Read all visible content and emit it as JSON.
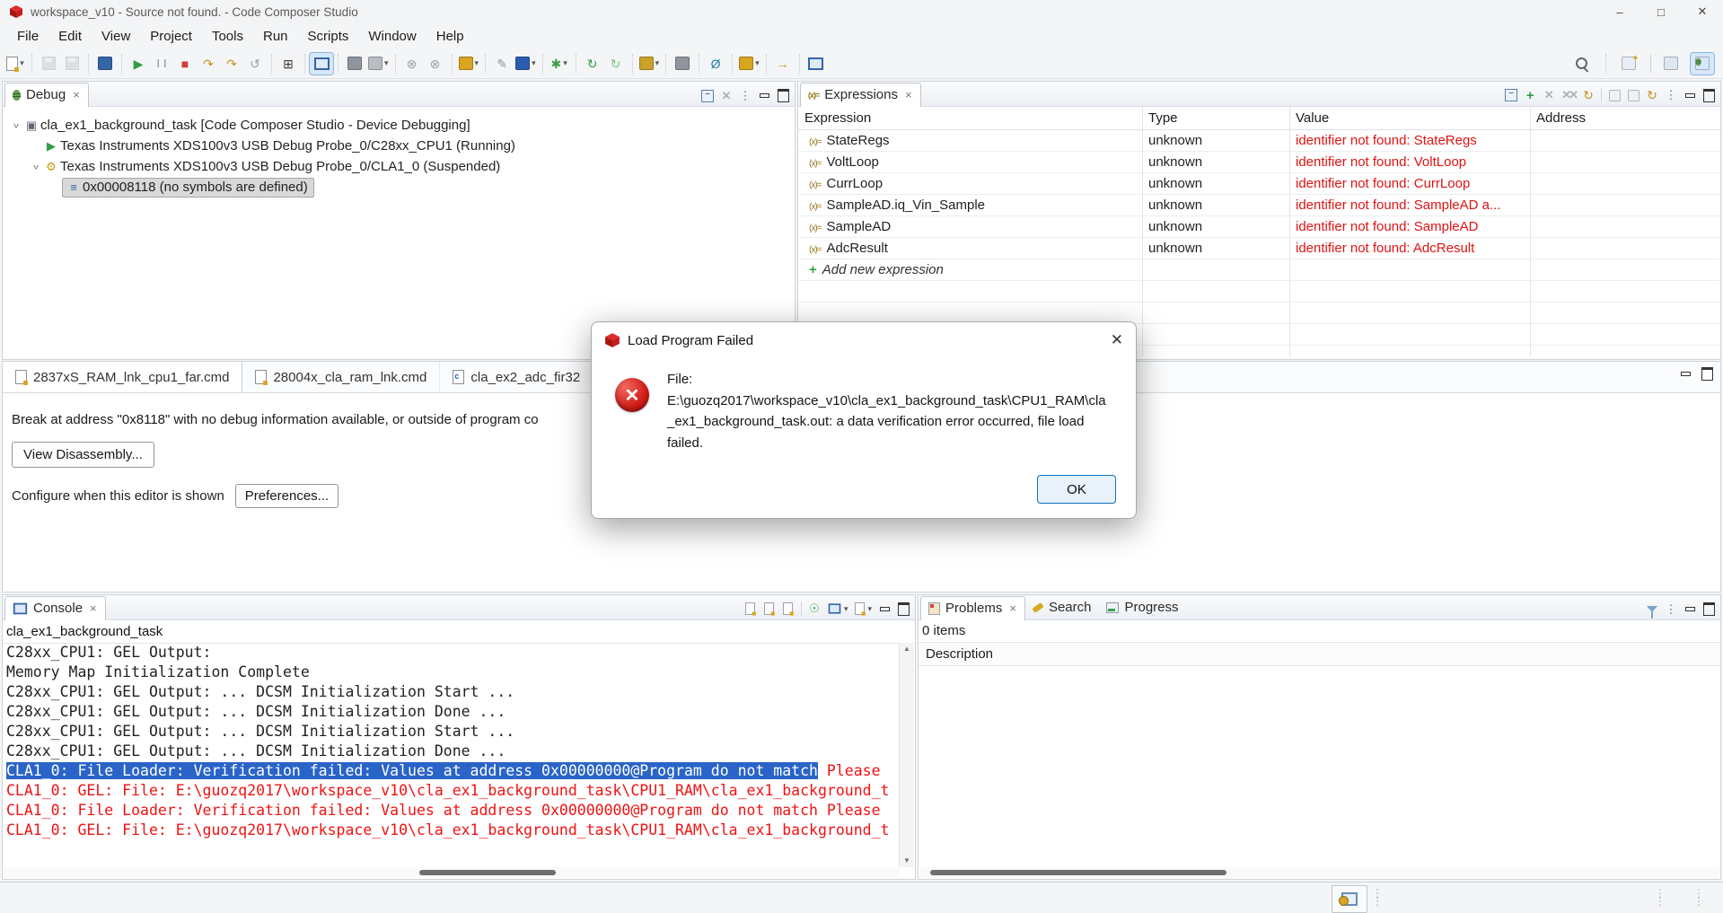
{
  "window": {
    "title": "workspace_v10 - Source not found. - Code Composer Studio"
  },
  "menubar": {
    "items": [
      "File",
      "Edit",
      "View",
      "Project",
      "Tools",
      "Run",
      "Scripts",
      "Window",
      "Help"
    ]
  },
  "main_toolbar": {
    "groups": [
      [
        {
          "n": "new-file-button",
          "css": "doc",
          "dd": 1
        }
      ],
      [
        {
          "n": "save-button",
          "css": "disk",
          "dis": 1
        },
        {
          "n": "save-all-button",
          "css": "disk",
          "dis": 1
        }
      ],
      [
        {
          "n": "build-button",
          "chip": "#3465a4"
        }
      ],
      [
        {
          "n": "resume-button",
          "g": "▶",
          "c": "#2f9e44"
        },
        {
          "n": "pause-button",
          "g": "❙❙",
          "c": "#9aa0a6",
          "small": 1
        },
        {
          "n": "stop-button",
          "g": "■",
          "c": "#d43a3a"
        },
        {
          "n": "step-into-button",
          "g": "↷",
          "c": "#c8941a"
        },
        {
          "n": "step-over-button",
          "g": "↷",
          "c": "#c8941a"
        },
        {
          "n": "step-return-button",
          "g": "↺",
          "c": "#9aa0a6"
        }
      ],
      [
        {
          "n": "registers-button",
          "g": "⊞",
          "c": "#3b3b3b"
        }
      ],
      [
        {
          "n": "source-lookup-button",
          "css": "mon",
          "hl": 1
        }
      ],
      [
        {
          "n": "profile-button",
          "chip": "#8f959c"
        },
        {
          "n": "trace-button",
          "chip": "#b9bec4",
          "dd": 1
        }
      ],
      [
        {
          "n": "skip-all-breakpoints-button",
          "g": "⊗",
          "c": "#9aa0a6"
        },
        {
          "n": "remove-breakpoints-button",
          "g": "⊗",
          "c": "#9aa0a6"
        }
      ],
      [
        {
          "n": "flash-button",
          "chip": "#d9a520",
          "dd": 1
        }
      ],
      [
        {
          "n": "memory-save-button",
          "g": "✎",
          "c": "#8f959c"
        },
        {
          "n": "pin-expression-button",
          "chip": "#2a5db0",
          "dd": 1
        }
      ],
      [
        {
          "n": "new-breakpoint-button",
          "g": "✱",
          "c": "#3f9e4d",
          "dd": 1
        }
      ],
      [
        {
          "n": "refresh-button",
          "g": "↻",
          "c": "#2f9e44"
        },
        {
          "n": "reload-program-button",
          "g": "↻",
          "c": "#7bc47f"
        }
      ],
      [
        {
          "n": "build-hammer-button",
          "chip": "#c9a227",
          "dd": 1
        }
      ],
      [
        {
          "n": "target-config-button",
          "chip": "#8f959c"
        }
      ],
      [
        {
          "n": "halt-button",
          "g": "Ø",
          "c": "#1e7ea1"
        }
      ],
      [
        {
          "n": "flashlight-button",
          "chip": "#d9a520",
          "dd": 1
        }
      ],
      [
        {
          "n": "forward-button",
          "g": "→",
          "c": "#c8941a"
        }
      ],
      [
        {
          "n": "open-new-view-button",
          "css": "mon"
        }
      ]
    ],
    "right": {
      "search": "search-button",
      "open_perspective": "open-perspective-button",
      "perspectives": [
        {
          "n": "ccs-edit-perspective-button",
          "active": false
        },
        {
          "n": "ccs-debug-perspective-button",
          "active": true
        }
      ]
    }
  },
  "debug_panel": {
    "tab": "Debug",
    "tree": [
      {
        "depth": 0,
        "chev": "v",
        "icon": "session",
        "label": "cla_ex1_background_task [Code Composer Studio - Device Debugging]",
        "selected": false
      },
      {
        "depth": 1,
        "chev": "",
        "icon": "running",
        "label": "Texas Instruments XDS100v3 USB Debug Probe_0/C28xx_CPU1 (Running)",
        "selected": false
      },
      {
        "depth": 1,
        "chev": "v",
        "icon": "suspended",
        "label": "Texas Instruments XDS100v3 USB Debug Probe_0/CLA1_0 (Suspended)",
        "selected": false
      },
      {
        "depth": 2,
        "chev": "",
        "icon": "frame",
        "label": "0x00008118  (no symbols are defined)",
        "selected": true
      }
    ],
    "icon_glyphs": {
      "session": [
        "▣",
        "#5f6771"
      ],
      "running": [
        "▶",
        "#2f9e44"
      ],
      "suspended": [
        "⚙",
        "#c59a1a"
      ],
      "frame": [
        "≡",
        "#3465a4"
      ]
    }
  },
  "expressions_panel": {
    "tab": "Expressions",
    "columns": [
      "Expression",
      "Type",
      "Value",
      "Address"
    ],
    "rows": [
      {
        "expression": "StateRegs",
        "type": "unknown",
        "value": "identifier not found: StateRegs",
        "address": ""
      },
      {
        "expression": "VoltLoop",
        "type": "unknown",
        "value": "identifier not found: VoltLoop",
        "address": ""
      },
      {
        "expression": "CurrLoop",
        "type": "unknown",
        "value": "identifier not found: CurrLoop",
        "address": ""
      },
      {
        "expression": "SampleAD.iq_Vin_Sample",
        "type": "unknown",
        "value": "identifier not found: SampleAD a...",
        "address": ""
      },
      {
        "expression": "SampleAD",
        "type": "unknown",
        "value": "identifier not found: SampleAD",
        "address": ""
      },
      {
        "expression": "AdcResult",
        "type": "unknown",
        "value": "identifier not found: AdcResult",
        "address": ""
      }
    ],
    "add_row_label": "Add new expression",
    "empty_row_count": 4
  },
  "editor_area": {
    "tabs": [
      {
        "label": "2837xS_RAM_lnk_cpu1_far.cmd",
        "icon": "cmd-file",
        "active": true
      },
      {
        "label": "28004x_cla_ram_lnk.cmd",
        "icon": "cmd-file",
        "active": false
      },
      {
        "label": "cla_ex2_adc_fir32",
        "icon": "c-file",
        "active": false
      }
    ],
    "message": "Break at address \"0x8118\" with no debug information available, or outside of program co",
    "view_disassembly_label": "View Disassembly...",
    "configure_text": "Configure when this editor is shown",
    "preferences_label": "Preferences..."
  },
  "dialog": {
    "title": "Load Program Failed",
    "message_lines": [
      "File:",
      "E:\\guozq2017\\workspace_v10\\cla_ex1_background_task\\CPU1_RAM\\cla",
      "_ex1_background_task.out: a data verification error occurred, file load",
      "failed."
    ],
    "ok_label": "OK"
  },
  "console_panel": {
    "tab": "Console",
    "subtitle": "cla_ex1_background_task",
    "lines": [
      {
        "text": "C28xx_CPU1: GEL Output: ",
        "style": "normal"
      },
      {
        "text": "Memory Map Initialization Complete",
        "style": "normal"
      },
      {
        "text": "C28xx_CPU1: GEL Output: ... DCSM Initialization Start ...",
        "style": "normal"
      },
      {
        "text": "C28xx_CPU1: GEL Output: ... DCSM Initialization Done ...",
        "style": "normal"
      },
      {
        "text": "C28xx_CPU1: GEL Output: ... DCSM Initialization Start ...",
        "style": "normal"
      },
      {
        "text": "C28xx_CPU1: GEL Output: ... DCSM Initialization Done ...",
        "style": "normal"
      },
      {
        "text": "CLA1_0: File Loader: Verification failed: Values at address 0x00000000@Program do not match",
        "style": "error",
        "selected": true,
        "suffix": " Please"
      },
      {
        "text": "CLA1_0: GEL: File: E:\\guozq2017\\workspace_v10\\cla_ex1_background_task\\CPU1_RAM\\cla_ex1_background_t",
        "style": "error"
      },
      {
        "text": "CLA1_0: File Loader: Verification failed: Values at address 0x00000000@Program do not match Please",
        "style": "error"
      },
      {
        "text": "CLA1_0: GEL: File: E:\\guozq2017\\workspace_v10\\cla_ex1_background_task\\CPU1_RAM\\cla_ex1_background_t",
        "style": "error"
      }
    ]
  },
  "problems_panel": {
    "tabs": [
      {
        "label": "Problems",
        "icon": "problems",
        "active": true
      },
      {
        "label": "Search",
        "icon": "search",
        "active": false
      },
      {
        "label": "Progress",
        "icon": "progress",
        "active": false
      }
    ],
    "items_count": "0 items",
    "column": "Description"
  },
  "colors": {
    "error_red": "#e01313",
    "selection_blue": "#2a64c8",
    "accent": "#3465a4"
  }
}
